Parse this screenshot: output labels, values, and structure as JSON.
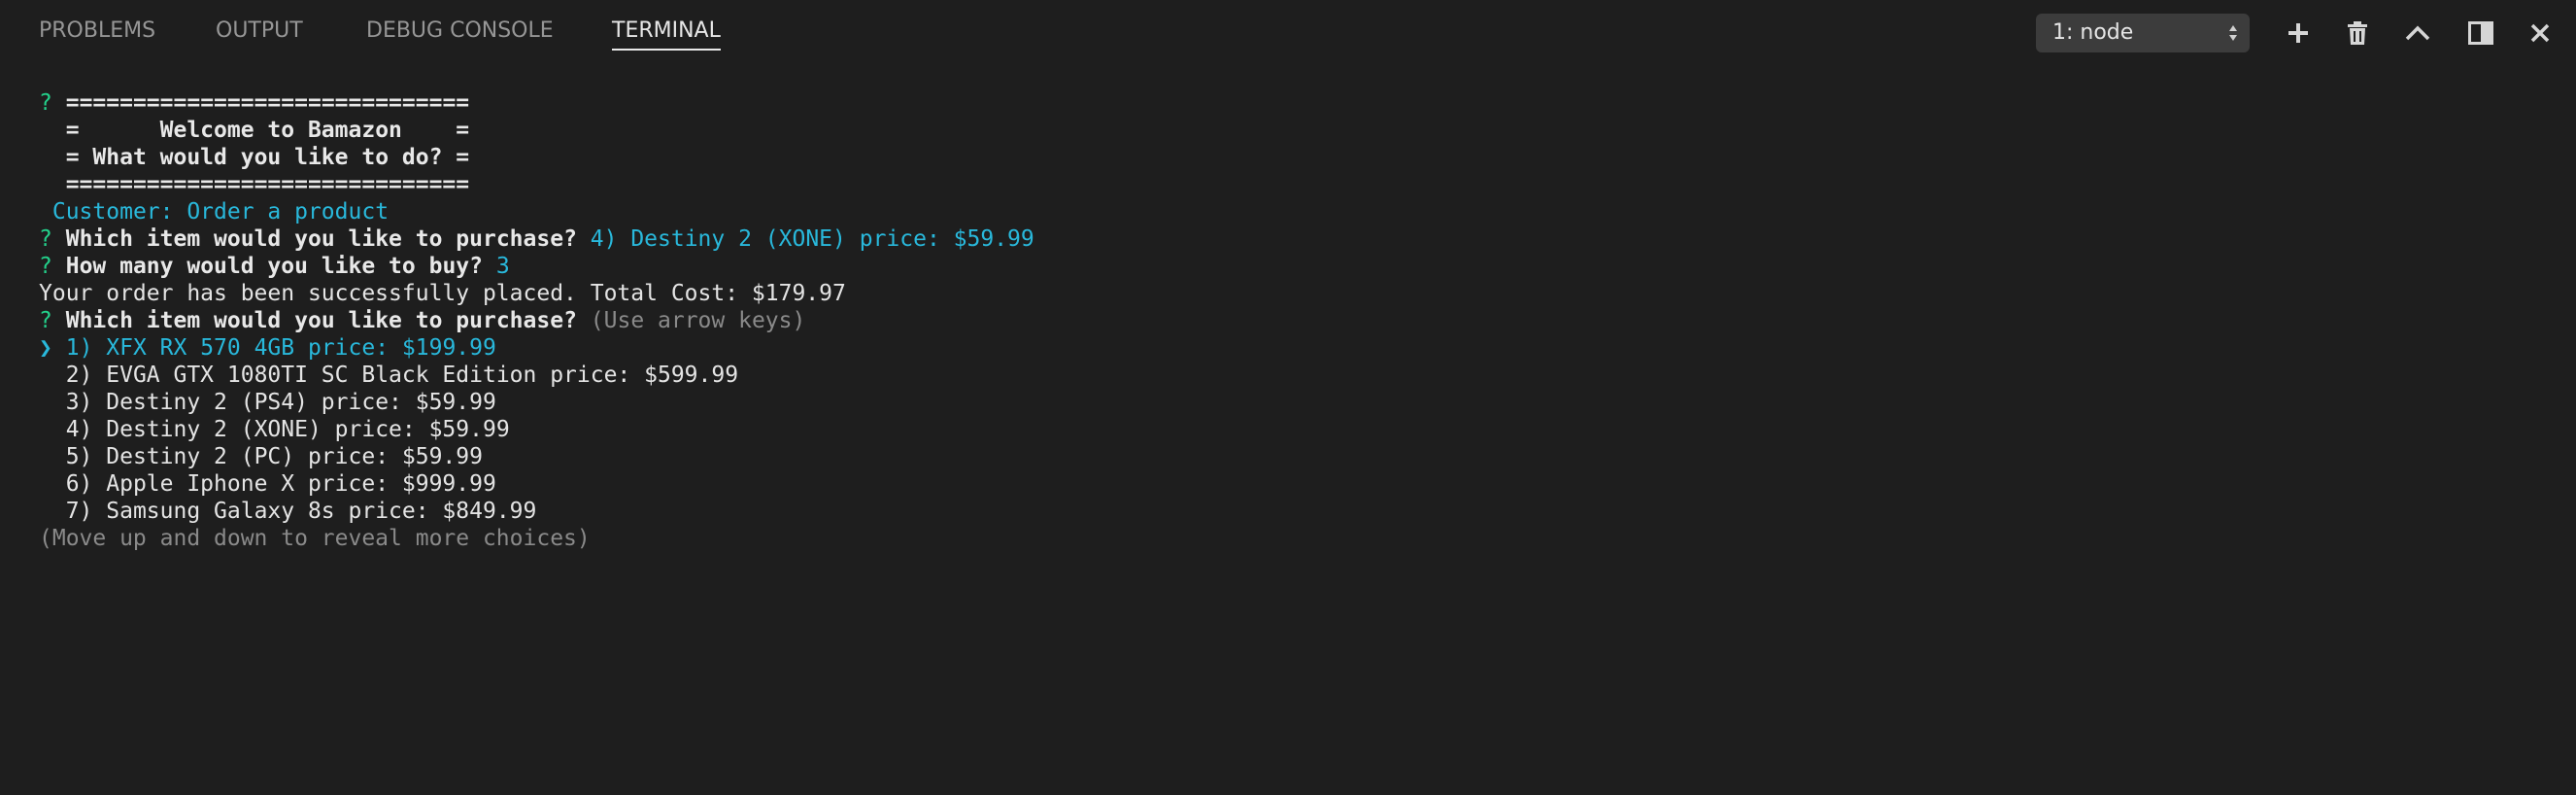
{
  "panel": {
    "tabs": [
      {
        "label": "PROBLEMS",
        "active": false
      },
      {
        "label": "OUTPUT",
        "active": false
      },
      {
        "label": "DEBUG CONSOLE",
        "active": false
      },
      {
        "label": "TERMINAL",
        "active": true
      }
    ],
    "terminal_select": {
      "value": "1: node"
    },
    "actions": [
      {
        "name": "new-terminal",
        "icon": "plus-icon"
      },
      {
        "name": "kill-terminal",
        "icon": "trash-icon"
      },
      {
        "name": "maximize-panel",
        "icon": "chevron-up-icon"
      },
      {
        "name": "split-terminal",
        "icon": "split-icon"
      },
      {
        "name": "close-panel",
        "icon": "close-icon"
      }
    ]
  },
  "terminal": {
    "menu": {
      "prompt_mark": "?",
      "border_top": "==============================",
      "title_line": "=      Welcome to Bamazon    =",
      "question_line": "= What would you like to do? =",
      "border_bottom": "==============================",
      "answer": "Customer: Order a product"
    },
    "item_question": {
      "prompt_mark": "?",
      "text": "Which item would you like to purchase?",
      "answer": "4) Destiny 2 (XONE) price: $59.99"
    },
    "quantity_question": {
      "prompt_mark": "?",
      "text": "How many would you like to buy?",
      "answer": "3"
    },
    "order_result": "Your order has been successfully placed. Total Cost: $179.97",
    "item_question_2": {
      "prompt_mark": "?",
      "text": "Which item would you like to purchase?",
      "hint": "(Use arrow keys)"
    },
    "cursor": "❯",
    "choices": [
      "1) XFX RX 570 4GB price: $199.99",
      "2) EVGA GTX 1080TI SC Black Edition price: $599.99",
      "3) Destiny 2 (PS4) price: $59.99",
      "4) Destiny 2 (XONE) price: $59.99",
      "5) Destiny 2 (PC) price: $59.99",
      "6) Apple Iphone X price: $999.99",
      "7) Samsung Galaxy 8s price: $849.99"
    ],
    "selected_index": 0,
    "footer_hint": "(Move up and down to reveal more choices)"
  },
  "colors": {
    "background": "#1e1e1e",
    "prompt_green": "#23d18b",
    "answer_cyan": "#29b8db",
    "dim_gray": "#8a8a8a",
    "text": "#e4e4e4"
  }
}
